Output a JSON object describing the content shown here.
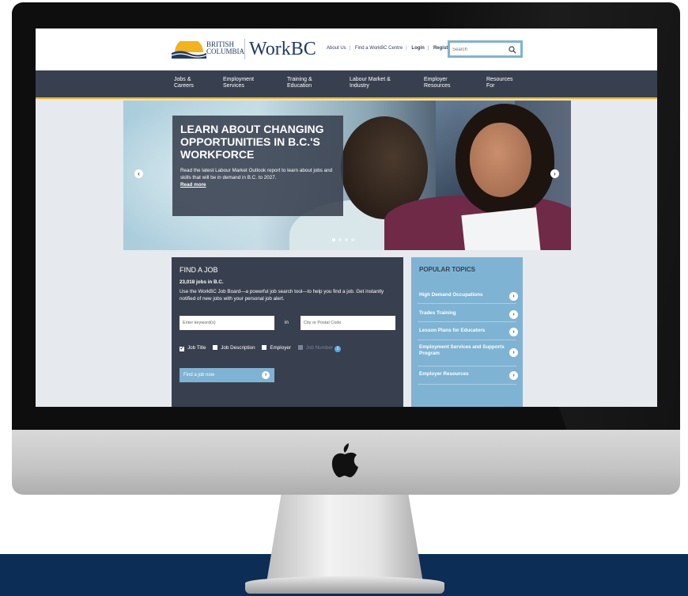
{
  "header": {
    "logo_line1": "BRITISH",
    "logo_line2": "COLUMBIA",
    "brand": "WorkBC",
    "links": [
      "About Us",
      "Find a WorkBC Centre",
      "Login",
      "Register"
    ],
    "search_placeholder": "Search"
  },
  "nav": {
    "items": [
      {
        "line1": "Jobs &",
        "line2": "Careers"
      },
      {
        "line1": "Employment",
        "line2": "Services"
      },
      {
        "line1": "Training &",
        "line2": "Education"
      },
      {
        "line1": "Labour Market &",
        "line2": "Industry"
      },
      {
        "line1": "Employer",
        "line2": "Resources"
      },
      {
        "line1": "Resources",
        "line2": "For"
      }
    ]
  },
  "hero": {
    "title": "LEARN ABOUT CHANGING OPPORTUNITIES IN B.C.'S WORKFORCE",
    "description": "Read the latest Labour Market Outlook report to learn about jobs and skills that will be in demand in B.C. to 2027.",
    "read_more": "Read more",
    "prev_arrow": "‹",
    "next_arrow": "›"
  },
  "find_job": {
    "title": "FIND A JOB",
    "count": "23,018 jobs in B.C.",
    "description": "Use the WorkBC Job Board—a powerful job search tool—to help you find a job. Get instantly notified of new jobs with your personal job alert.",
    "keyword_placeholder": "Enter keyword(s)",
    "in_label": "in",
    "location_placeholder": "City or Postal Code",
    "checks": [
      "Job Title",
      "Job Description",
      "Employer",
      "Job Number"
    ],
    "button_label": "Find a job now",
    "button_arrow": "›",
    "checked_glyph": "✔",
    "info_glyph": "i"
  },
  "popular": {
    "title": "POPULAR TOPICS",
    "items": [
      "High Demand Occupations",
      "Trades Training",
      "Lesson Plans for Educators",
      "Employment Services and Supports Program",
      "Employer Resources"
    ],
    "arrow": "›"
  },
  "colors": {
    "navbar": "#38404f",
    "accent_yellow": "#f2b31c",
    "accent_blue": "#7fb3d3",
    "floor": "#0c2d55"
  }
}
